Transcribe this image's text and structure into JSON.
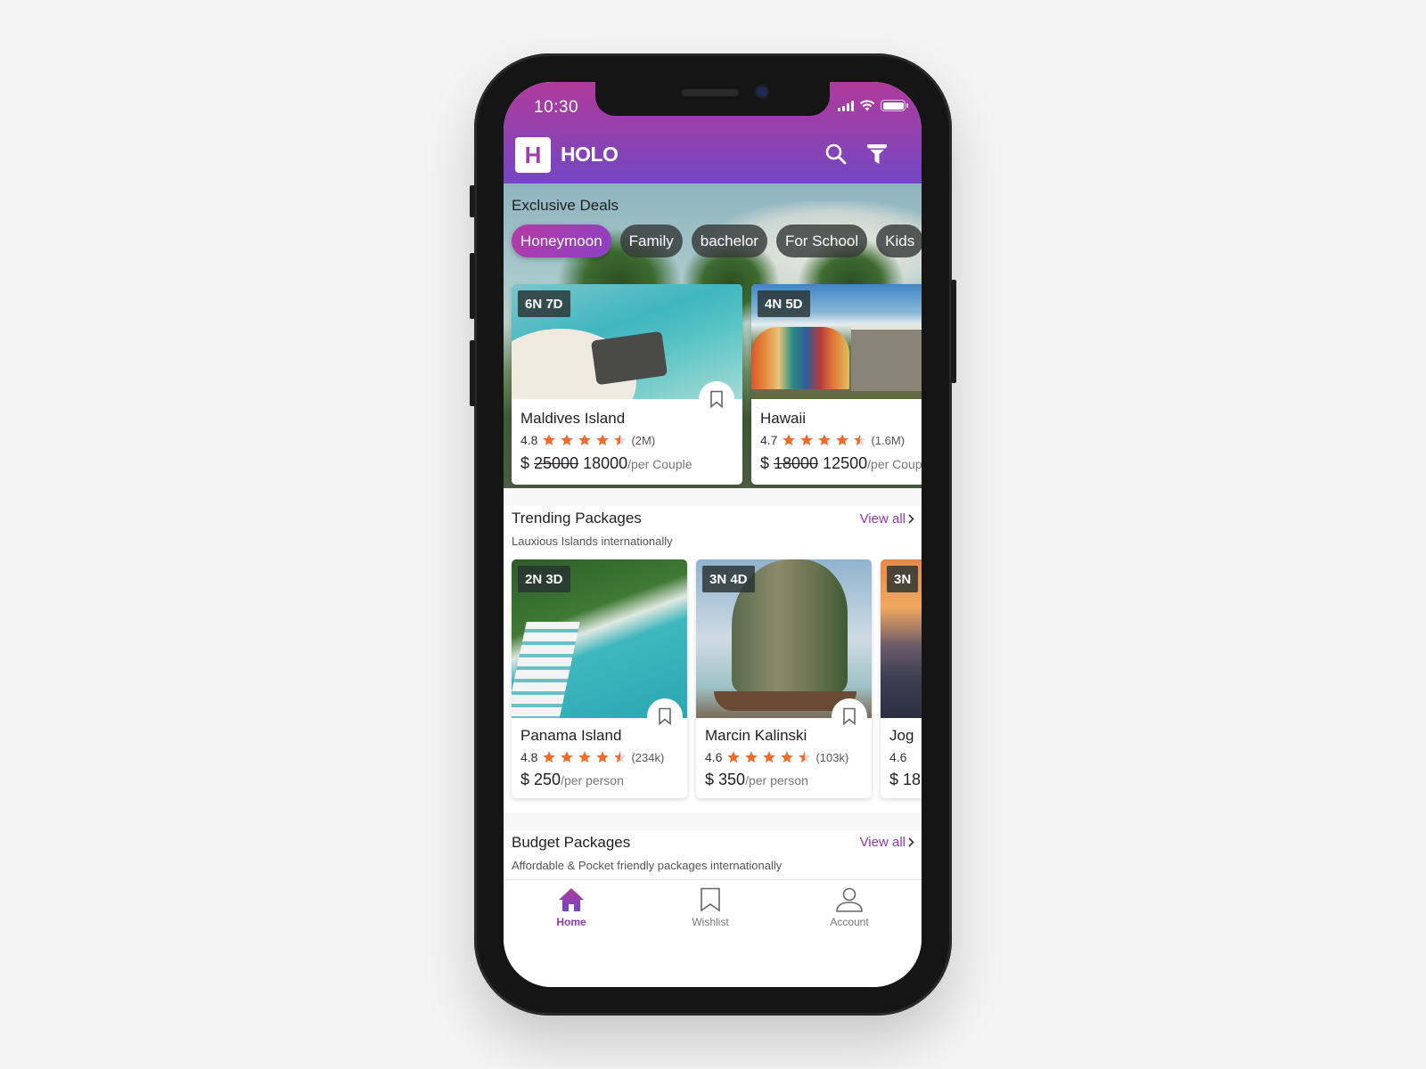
{
  "status_bar": {
    "time": "10:30"
  },
  "header": {
    "logo_letter": "H",
    "app_name": "HOLO",
    "search_icon": "search-icon",
    "filter_icon": "filter-icon"
  },
  "exclusive_deals": {
    "title": "Exclusive Deals",
    "chips": [
      {
        "label": "Honeymoon",
        "active": true
      },
      {
        "label": "Family",
        "active": false
      },
      {
        "label": "bachelor",
        "active": false
      },
      {
        "label": "For School",
        "active": false
      },
      {
        "label": "Kids",
        "active": false
      }
    ],
    "cards": [
      {
        "duration": "6N 7D",
        "name": "Maldives Island",
        "rating": "4.8",
        "stars": 4.5,
        "reviews": "(2M)",
        "currency": "$",
        "old_price": "25000",
        "price": "18000",
        "unit": "/per Couple"
      },
      {
        "duration": "4N 5D",
        "name": "Hawaii",
        "rating": "4.7",
        "stars": 4.5,
        "reviews": "(1.6M)",
        "currency": "$",
        "old_price": "18000",
        "price": "12500",
        "unit": "/per Couple"
      }
    ]
  },
  "trending": {
    "title": "Trending Packages",
    "subtitle": "Lauxious Islands internationally",
    "view_all": "View all",
    "cards": [
      {
        "duration": "2N 3D",
        "name": "Panama Island",
        "rating": "4.8",
        "stars": 4.5,
        "reviews": "(234k)",
        "currency": "$",
        "price": "250",
        "unit": "/per person"
      },
      {
        "duration": "3N 4D",
        "name": "Marcin Kalinski",
        "rating": "4.6",
        "stars": 4.5,
        "reviews": "(103k)",
        "currency": "$",
        "price": "350",
        "unit": "/per person"
      },
      {
        "duration": "3N",
        "name": "Jog",
        "rating": "4.6",
        "stars": 4.5,
        "reviews": "",
        "currency": "$",
        "price": "18",
        "unit": ""
      }
    ]
  },
  "budget": {
    "title": "Budget Packages",
    "subtitle": "Affordable & Pocket friendly packages internationally",
    "view_all": "View all"
  },
  "tabbar": {
    "items": [
      {
        "label": "Home",
        "icon": "home-icon",
        "active": true
      },
      {
        "label": "Wishlist",
        "icon": "bookmark-icon",
        "active": false
      },
      {
        "label": "Account",
        "icon": "user-icon",
        "active": false
      }
    ]
  },
  "colors": {
    "accent": "#8a3aa8",
    "gradient_start": "#b63aa4",
    "gradient_end": "#7246c3",
    "star": "#f26b2a"
  }
}
